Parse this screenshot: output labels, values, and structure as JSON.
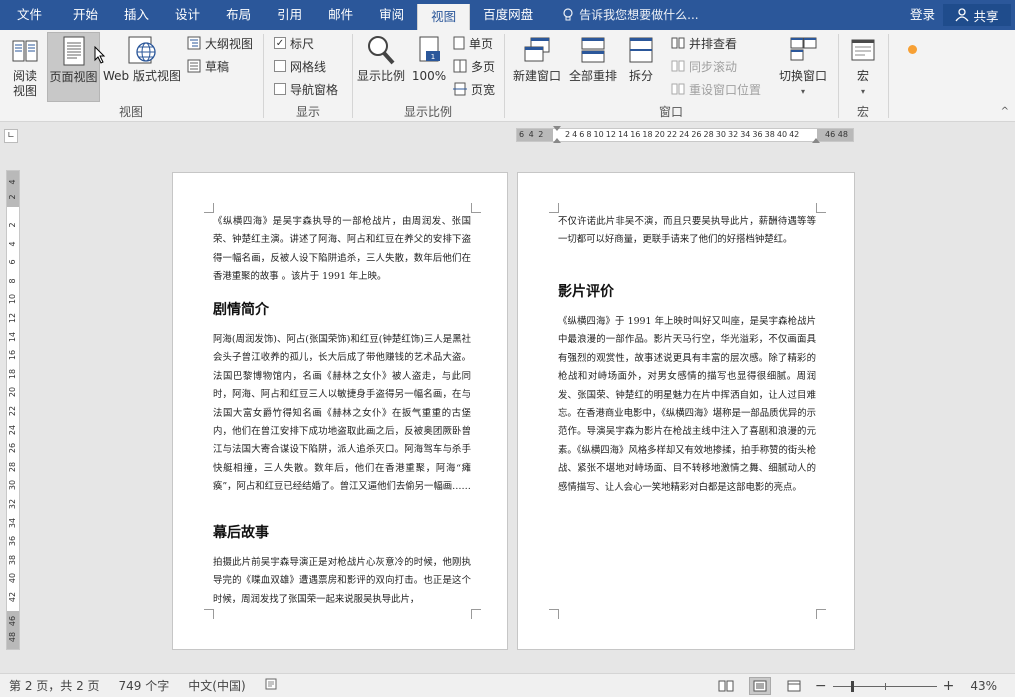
{
  "tabs": [
    {
      "label": "文件",
      "active": false
    },
    {
      "label": "开始",
      "active": false
    },
    {
      "label": "插入",
      "active": false
    },
    {
      "label": "设计",
      "active": false
    },
    {
      "label": "布局",
      "active": false
    },
    {
      "label": "引用",
      "active": false
    },
    {
      "label": "邮件",
      "active": false
    },
    {
      "label": "审阅",
      "active": false
    },
    {
      "label": "视图",
      "active": true
    },
    {
      "label": "百度网盘",
      "active": false
    }
  ],
  "tell_me": "告诉我您想要做什么...",
  "login": "登录",
  "share": "共享",
  "ribbon": {
    "views": {
      "label": "视图",
      "read_mode": "阅读\n视图",
      "print_layout": "页面视图",
      "web_layout": "Web 版式视图",
      "outline": "大纲视图",
      "draft": "草稿"
    },
    "show": {
      "label": "显示",
      "ruler": "标尺",
      "ruler_checked": "✓",
      "gridlines": "网格线",
      "navigation": "导航窗格"
    },
    "zoom": {
      "label": "显示比例",
      "zoom": "显示比例",
      "hundred": "100%",
      "one_page": "单页",
      "multi_page": "多页",
      "page_width": "页宽"
    },
    "window": {
      "label": "窗口",
      "new_window": "新建窗口",
      "arrange_all": "全部重排",
      "split": "拆分",
      "side_by_side": "并排查看",
      "sync_scroll": "同步滚动",
      "reset_position": "重设窗口位置",
      "switch": "切换窗口"
    },
    "macros": {
      "label": "宏",
      "macro": "宏"
    }
  },
  "ruler": {
    "h_left_gray": "6 4 2",
    "h_ticks": "2 4 6 8 10 12 14 16 18 20 22 24 26 28 30 32 34 36 38 40 42",
    "h_right_gray": "46 48",
    "v_top": [
      "4",
      "2"
    ],
    "v_ticks": [
      "2",
      "4",
      "6",
      "8",
      "10",
      "12",
      "14",
      "16",
      "18",
      "20",
      "22",
      "24",
      "26",
      "28",
      "30",
      "32",
      "34",
      "36",
      "38",
      "40",
      "42"
    ],
    "v_bottom": [
      "46",
      "48"
    ]
  },
  "page1": {
    "intro": "《纵横四海》是吴宇森执导的一部枪战片，由周润发、张国荣、钟楚红主演。讲述了阿海、阿占和红豆在养父的安排下盗得一幅名画，反被人设下陷阱追杀，三人失散，数年后他们在香港重聚的故事 。该片于 1991 年上映。",
    "heading1": "剧情简介",
    "plot": "阿海(周润发饰)、阿占(张国荣饰)和红豆(钟楚红饰)三人是黑社会头子曾江收养的孤儿，长大后成了带他赚钱的艺术品大盗。法国巴黎博物馆内，名画《赫林之女仆》被人盗走，与此同时，阿海、阿占和红豆三人以敏捷身手盗得另一幅名画，在与法国大富女爵竹得知名画《赫林之女仆》在扳气重重的古堡内，他们在曾江安排下成功地盗取此画之后，反被奥团厥卧曾江与法国大寄合谋设下陷阱，派人追杀灭口。阿海驾车与杀手快艇相撞，三人失散。数年后，他们在香港重聚，阿海“瘫痪”，阿占和红豆已经结婚了。曾江又逼他们去偷另一幅画……",
    "heading2": "幕后故事",
    "behind": "拍摄此片前吴宇森导演正是对枪战片心灰意冷的时候，他刚执导完的《喋血双雄》遭遇票房和影评的双向打击。也正是这个时候，周润发找了张国荣一起来说服吴执导此片，"
  },
  "page2": {
    "cont": "不仅许诺此片非吴不演，而且只要吴执导此片，薪酬待遇等等一切都可以好商量，更联手请来了他们的好搭档钟楚红。",
    "heading": "影片评价",
    "review": "《纵横四海》于 1991 年上映时叫好又叫座，是吴宇森枪战片中最浪漫的一部作品。影片天马行空，华光溢彩，不仅画面具有强烈的观赏性，故事述说更具有丰富的层次感。除了精彩的枪战和对峙场面外，对男女感情的描写也显得很细腻。周润发、张国荣、钟楚红的明星魅力在片中挥洒自如，让人过目难忘。在香港商业电影中，《纵横四海》堪称是一部品质优异的示范作。导演吴宇森为影片在枪战主线中注入了喜剧和浪漫的元素。《纵横四海》风格多样却又有效地掺揉，拍手称赞的街头枪战、紧张不堪地对峙场面、目不转移地激情之舞、细腻动人的感情描写、让人会心一笑地精彩对白都是这部电影的亮点。"
  },
  "status": {
    "page": "第 2 页，共 2 页",
    "words": "749 个字",
    "lang": "中文(中国)",
    "zoom_pct": "43%",
    "zoom_minus": "−",
    "zoom_plus": "+",
    "zoom_value": 0.43
  },
  "colors": {
    "accent": "#2b579a",
    "ribbon_bg": "#f3f3f3",
    "workspace": "#e6e6e6"
  }
}
